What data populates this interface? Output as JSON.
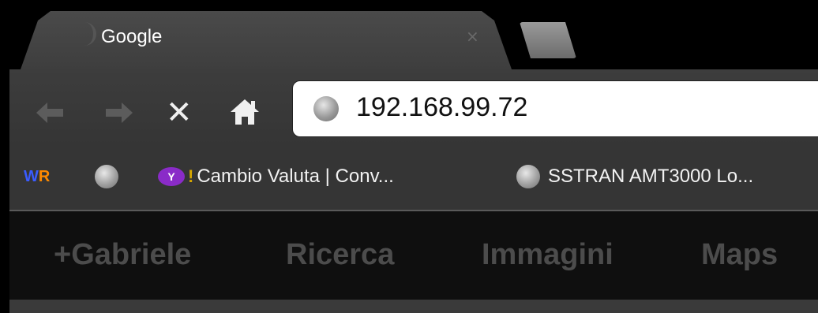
{
  "tab": {
    "title": "Google",
    "close_label": "×"
  },
  "toolbar": {
    "back_icon": "back-arrow-icon",
    "forward_icon": "forward-arrow-icon",
    "stop_label": "✕",
    "home_label": "⌂",
    "address": "192.168.99.72"
  },
  "bookmarks": {
    "items": [
      {
        "label": "",
        "icon": "wr-icon"
      },
      {
        "label": "",
        "icon": "globe-icon"
      },
      {
        "label": "Cambio Valuta | Conv...",
        "icon": "yahoo-icon"
      },
      {
        "label": "SSTRAN AMT3000 Lo...",
        "icon": "globe-icon"
      }
    ]
  },
  "google_bar": {
    "items": [
      "+Gabriele",
      "Ricerca",
      "Immagini",
      "Maps"
    ]
  },
  "colors": {
    "chrome_dark": "#353535",
    "google_bar_bg": "#0f0f0f",
    "google_bar_text": "#4c4c4c",
    "yahoo_purple": "#8a2bc8"
  }
}
